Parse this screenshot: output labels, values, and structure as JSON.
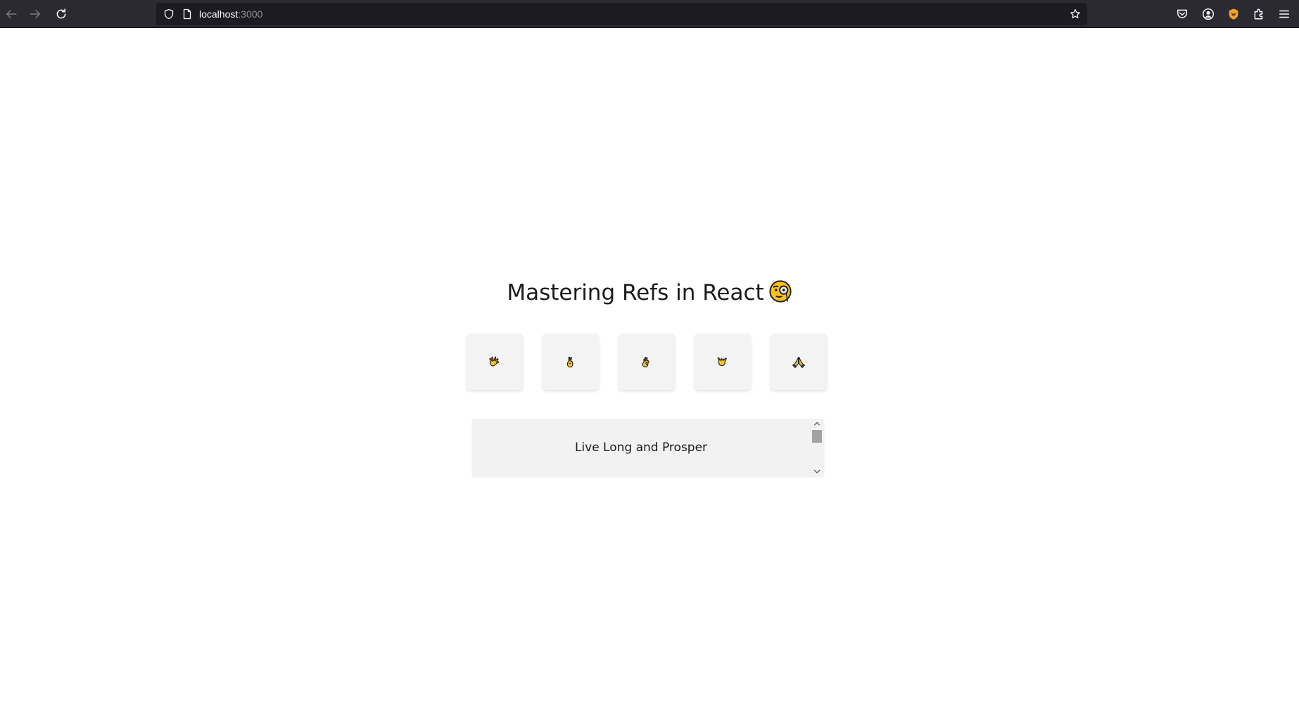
{
  "browser": {
    "url_host": "localhost",
    "url_port": ":3000",
    "icons": {
      "back": "arrow-left-icon",
      "forward": "arrow-right-icon",
      "reload": "reload-icon",
      "shield": "shield-icon",
      "page": "page-icon",
      "bookmark": "star-icon",
      "pocket": "pocket-icon",
      "account": "account-icon",
      "extension_fox": "fox-extension-icon",
      "extensions": "puzzle-icon",
      "menu": "hamburger-menu-icon"
    }
  },
  "page": {
    "title": "Mastering Refs in React",
    "title_emoji": "monocle-face-icon",
    "gestures": [
      {
        "name": "vulcan-salute-icon"
      },
      {
        "name": "crossed-fingers-icon"
      },
      {
        "name": "ok-hand-icon"
      },
      {
        "name": "call-me-hand-icon"
      },
      {
        "name": "folded-hands-icon"
      }
    ],
    "scroll_box_text": "Live Long and Prosper",
    "scroll_position": 0.0
  },
  "colors": {
    "toolbar_bg": "#2b2a33",
    "urlbar_bg": "#1c1b22",
    "tile_bg": "#f3f3f3",
    "emoji_yellow": "#fcc21b",
    "emoji_outline": "#1b1b1b"
  }
}
